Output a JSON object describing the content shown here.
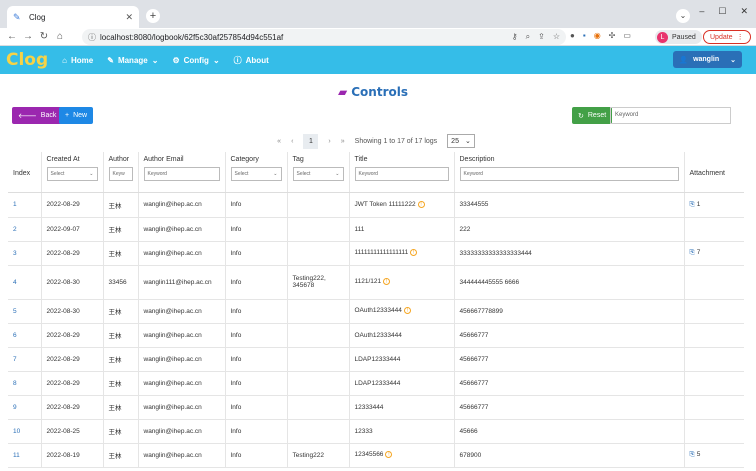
{
  "browser": {
    "tab_title": "Clog",
    "url": "localhost:8080/logbook/62f5c30af257854d94c551af",
    "profile_initial": "L",
    "profile_label": "Paused",
    "update_label": "Update"
  },
  "nav": {
    "brand": "Clog",
    "items": [
      {
        "label": "Home",
        "icon": "home-icon"
      },
      {
        "label": "Manage",
        "icon": "wrench-icon",
        "dropdown": true
      },
      {
        "label": "Config",
        "icon": "gear-icon",
        "dropdown": true
      },
      {
        "label": "About",
        "icon": "info-icon"
      }
    ],
    "user": "wanglin"
  },
  "page": {
    "title": "Controls",
    "back_label": "Back",
    "new_label": "New",
    "reset_label": "Reset",
    "search_placeholder": "Keyword"
  },
  "pager": {
    "current_page": "1",
    "summary": "Showing 1 to 17 of 17 logs",
    "per_page": "25"
  },
  "table": {
    "headers": {
      "index": "Index",
      "created": "Created At",
      "author": "Author",
      "email": "Author Email",
      "category": "Category",
      "tag": "Tag",
      "title": "Title",
      "description": "Description",
      "attachment": "Attachment"
    },
    "filters": {
      "select": "Select",
      "keyword": "Keyword",
      "keyword_short": "Keyw"
    },
    "rows": [
      {
        "index": "1",
        "created": "2022-08-29",
        "author": "王林",
        "email": "wanglin@ihep.ac.cn",
        "category": "Info",
        "tag": "",
        "title": "JWT Token 11111222",
        "title_warn": true,
        "description": "33344555",
        "attachment": "1"
      },
      {
        "index": "2",
        "created": "2022-09-07",
        "author": "王林",
        "email": "wanglin@ihep.ac.cn",
        "category": "Info",
        "tag": "",
        "title": "111",
        "title_warn": false,
        "description": "222",
        "attachment": ""
      },
      {
        "index": "3",
        "created": "2022-08-29",
        "author": "王林",
        "email": "wanglin@ihep.ac.cn",
        "category": "Info",
        "tag": "",
        "title": "11111111111111111",
        "title_warn": true,
        "description": "33333333333333333444",
        "attachment": "7"
      },
      {
        "index": "4",
        "created": "2022-08-30",
        "author": "33456",
        "email": "wanglin111@ihep.ac.cn",
        "category": "Info",
        "tag": "Testing222, 345678",
        "title": "1121/121",
        "title_warn": true,
        "description": "344444445555 6666",
        "attachment": ""
      },
      {
        "index": "5",
        "created": "2022-08-30",
        "author": "王林",
        "email": "wanglin@ihep.ac.cn",
        "category": "Info",
        "tag": "",
        "title": "OAuth12333444",
        "title_warn": true,
        "description": "456667778899",
        "attachment": ""
      },
      {
        "index": "6",
        "created": "2022-08-29",
        "author": "王林",
        "email": "wanglin@ihep.ac.cn",
        "category": "Info",
        "tag": "",
        "title": "OAuth12333444",
        "title_warn": false,
        "description": "45666777",
        "attachment": ""
      },
      {
        "index": "7",
        "created": "2022-08-29",
        "author": "王林",
        "email": "wanglin@ihep.ac.cn",
        "category": "Info",
        "tag": "",
        "title": "LDAP12333444",
        "title_warn": false,
        "description": "45666777",
        "attachment": ""
      },
      {
        "index": "8",
        "created": "2022-08-29",
        "author": "王林",
        "email": "wanglin@ihep.ac.cn",
        "category": "Info",
        "tag": "",
        "title": "LDAP12333444",
        "title_warn": false,
        "description": "45666777",
        "attachment": ""
      },
      {
        "index": "9",
        "created": "2022-08-29",
        "author": "王林",
        "email": "wanglin@ihep.ac.cn",
        "category": "Info",
        "tag": "",
        "title": "12333444",
        "title_warn": false,
        "description": "45666777",
        "attachment": ""
      },
      {
        "index": "10",
        "created": "2022-08-25",
        "author": "王林",
        "email": "wanglin@ihep.ac.cn",
        "category": "Info",
        "tag": "",
        "title": "12333",
        "title_warn": false,
        "description": "45666",
        "attachment": ""
      },
      {
        "index": "11",
        "created": "2022-08-19",
        "author": "王林",
        "email": "wanglin@ihep.ac.cn",
        "category": "Info",
        "tag": "Testing222",
        "title": "12345566",
        "title_warn": true,
        "description": "678900",
        "attachment": "5"
      }
    ]
  }
}
